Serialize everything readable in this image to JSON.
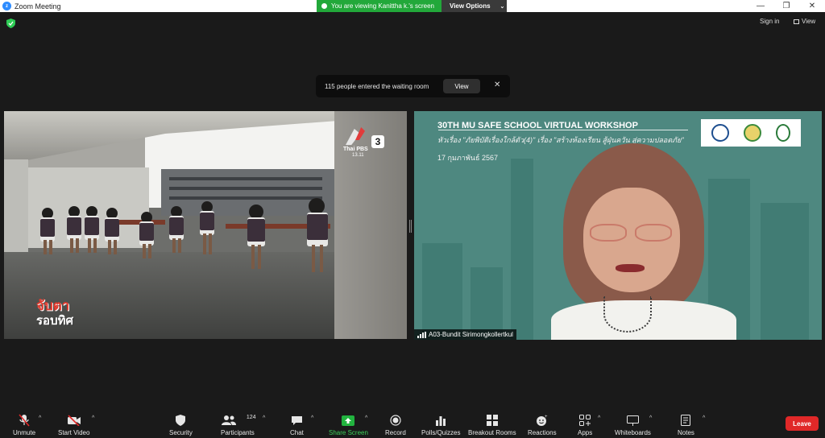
{
  "window": {
    "title": "Zoom Meeting",
    "viewing_banner": "You are viewing Kanittha k.'s screen",
    "view_options": "View Options"
  },
  "top_right": {
    "sign_in": "Sign in",
    "view": "View"
  },
  "notification": {
    "text": "115 people entered the waiting room",
    "view_button": "View"
  },
  "left_video": {
    "channel": "Thai PBS",
    "channel_number": "3",
    "clock": "13.11",
    "program_line1": "จับตา",
    "program_line2": "รอบทิศ"
  },
  "right_video": {
    "workshop_title": "30TH MU SAFE SCHOOL VIRTUAL WORKSHOP",
    "subtitle": "หัวเรื่อง \"ภัยพิบัติเรื่องใกล้ตัว(4)\" เรื่อง \"สร้างห้องเรียน สู้ฝุ่นควัน สู่ความปลอดภัย\"",
    "date": "17 กุมภาพันธ์ 2567",
    "participant_name": "A03-Bundit Sirimongkollertkul"
  },
  "toolbar": {
    "unmute": "Unmute",
    "start_video": "Start Video",
    "security": "Security",
    "participants": "Participants",
    "participants_count": "124",
    "chat": "Chat",
    "share_screen": "Share Screen",
    "record": "Record",
    "polls": "Polls/Quizzes",
    "breakout": "Breakout Rooms",
    "reactions": "Reactions",
    "apps": "Apps",
    "whiteboards": "Whiteboards",
    "notes": "Notes",
    "leave": "Leave"
  },
  "colors": {
    "share_green": "#3ecf5a",
    "leave_red": "#e02828",
    "banner_green": "#22a83a"
  }
}
